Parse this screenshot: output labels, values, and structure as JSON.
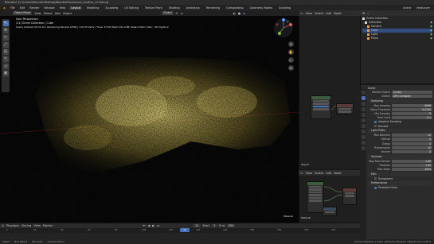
{
  "window": {
    "title": "Blender* [C:\\Users\\Blender\\Testing\\BlenderProcedural_Scatter_12.blend]"
  },
  "menu": {
    "items": [
      "File",
      "Edit",
      "Render",
      "Window",
      "Help"
    ],
    "workspaces": [
      "Layout",
      "Modeling",
      "Sculpting",
      "UV Editing",
      "Texture Paint",
      "Shading",
      "Animation",
      "Rendering",
      "Compositing",
      "Geometry Nodes",
      "Scripting"
    ],
    "active_workspace": "Layout",
    "scene": "Scene",
    "view_layer": "ViewLayer"
  },
  "viewport": {
    "mode": "Object Mode",
    "header_menus": [
      "View",
      "Select",
      "Add",
      "Object"
    ],
    "transform": "Global",
    "overlay_lines": [
      "User Perspective",
      "(11) Scene Collection | Cube",
      "Scene (Global) 00:31.91 | Rendering Sample 4/500 | 3.04 M Verts | Time: 27125 Mem:241.24M, Peak:2 Mem | Rerr | 3D Lights 2"
    ],
    "gizmo_axes": [
      "X",
      "Y",
      "Z"
    ],
    "corner_label": "Material",
    "tool_icons": [
      "cursor-icon",
      "move-icon",
      "rotate-icon",
      "scale-icon",
      "transform-icon",
      "annotate-icon",
      "measure-icon",
      "add-cube-icon"
    ],
    "side_tools": [
      "zoom-icon",
      "pan-icon",
      "camera-icon",
      "grid-icon"
    ]
  },
  "node_editor_top": {
    "header": [
      "View",
      "Select",
      "Add",
      "Node"
    ],
    "label": "Object",
    "nodes": [
      "Volume Scatter",
      "Material Output"
    ]
  },
  "node_editor_bottom": {
    "header": [
      "View",
      "Select",
      "Add",
      "Node"
    ],
    "label": "Material",
    "nodes": [
      "Principled Volume",
      "Material Output",
      "Mix Shader"
    ]
  },
  "outliner": {
    "title": "Scene Collection",
    "items": [
      {
        "name": "Collection",
        "color": "#e8e8e8",
        "indent": 1
      },
      {
        "name": "Camera",
        "color": "#e8a04a",
        "indent": 2
      },
      {
        "name": "Cube",
        "color": "#e8a04a",
        "indent": 2
      },
      {
        "name": "Light",
        "color": "#e8a04a",
        "indent": 2
      },
      {
        "name": "Plane",
        "color": "#e8a04a",
        "indent": 2
      }
    ]
  },
  "properties": {
    "header": "Scene",
    "engine_label": "Render Engine",
    "engine": "Cycles",
    "device_label": "Device",
    "device": "GPU Compute",
    "sections": {
      "sampling": "Sampling",
      "light_paths": "Light Paths",
      "volumes": "Volumes",
      "film": "Film",
      "performance": "Performance"
    },
    "fields": [
      {
        "label": "Max Samples",
        "value": "4096"
      },
      {
        "label": "Noise Threshold",
        "value": "0.0100"
      },
      {
        "label": "Min Samples",
        "value": "0"
      },
      {
        "label": "Time Limit",
        "value": "0 s"
      },
      {
        "label": "Max Bounces",
        "value": "12"
      },
      {
        "label": "Diffuse",
        "value": "4"
      },
      {
        "label": "Glossy",
        "value": "4"
      },
      {
        "label": "Transmission",
        "value": "12"
      },
      {
        "label": "Volume",
        "value": "0"
      },
      {
        "label": "Step Rate Render",
        "value": "1.00"
      },
      {
        "label": "Viewport",
        "value": "1.00"
      },
      {
        "label": "Max Steps",
        "value": "1024"
      }
    ],
    "checks": [
      {
        "label": "Adaptive Sampling",
        "on": true
      },
      {
        "label": "Denoise",
        "on": false
      },
      {
        "label": "Transparent",
        "on": false
      },
      {
        "label": "Persistent Data",
        "on": true
      }
    ]
  },
  "timeline": {
    "menus": [
      "Playback",
      "Keying",
      "View",
      "Marker"
    ],
    "current_frame": "11",
    "start_label": "Start",
    "start": "1",
    "end_label": "End",
    "end": "250",
    "ticks": [
      "0",
      "20",
      "40",
      "60",
      "80",
      "100",
      "120",
      "140",
      "160",
      "180",
      "200",
      "220",
      "240"
    ]
  },
  "statusbar": {
    "items": [
      "Select",
      "Box Select",
      "Pan View",
      "Context Menu"
    ],
    "version": "Scene Collection | Cube | Verts:8 | Faces:6 | Objects:1/5 | 2.93.0"
  },
  "colors": {
    "accent": "#4772b3",
    "scatter": "#c8b95a"
  }
}
